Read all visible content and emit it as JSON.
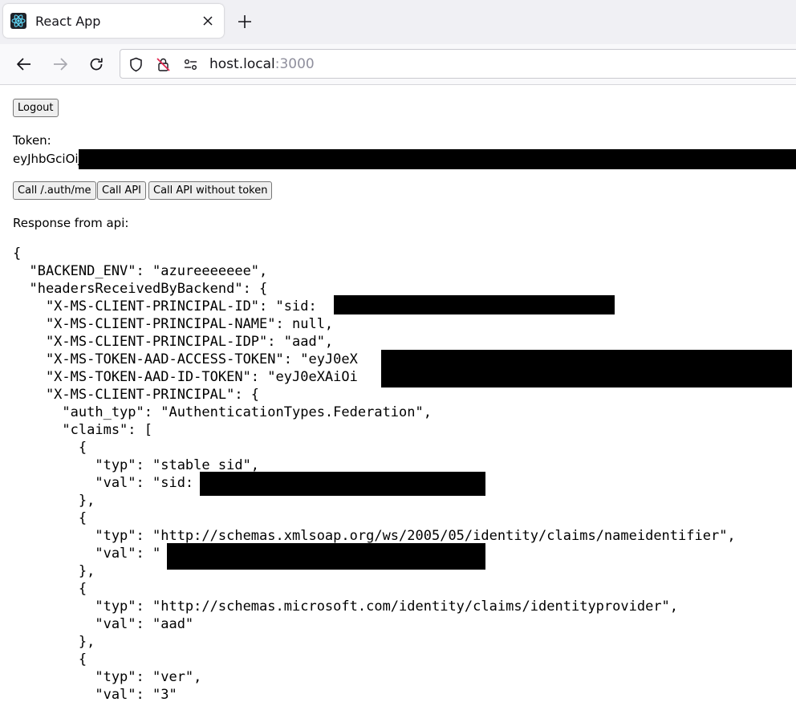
{
  "browser": {
    "tab": {
      "title": "React App",
      "favicon": "react-logo-icon"
    },
    "url": {
      "host": "host.local",
      "port": ":3000"
    }
  },
  "page": {
    "logout_label": "Logout",
    "token_label": "Token:",
    "token_value": "eyJhbGciOiJ",
    "buttons": {
      "call_auth_me": "Call /.auth/me",
      "call_api": "Call API",
      "call_api_no_token": "Call API without token"
    },
    "response_label": "Response from api:",
    "json_lines": [
      "{",
      "  \"BACKEND_ENV\": \"azureeeeeee\",",
      "  \"headersReceivedByBackend\": {",
      "    \"X-MS-CLIENT-PRINCIPAL-ID\": \"sid:                                \",",
      "    \"X-MS-CLIENT-PRINCIPAL-NAME\": null,",
      "    \"X-MS-CLIENT-PRINCIPAL-IDP\": \"aad\",",
      "    \"X-MS-TOKEN-AAD-ACCESS-TOKEN\": \"eyJ0eX",
      "    \"X-MS-TOKEN-AAD-ID-TOKEN\": \"eyJ0eXAiOi",
      "    \"X-MS-CLIENT-PRINCIPAL\": {",
      "      \"auth_typ\": \"AuthenticationTypes.Federation\",",
      "      \"claims\": [",
      "        {",
      "          \"typ\": \"stable_sid\",",
      "          \"val\": \"sid:                                \"",
      "        },",
      "        {",
      "          \"typ\": \"http://schemas.xmlsoap.org/ws/2005/05/identity/claims/nameidentifier\",",
      "          \"val\": \"                                     \"",
      "        },",
      "        {",
      "          \"typ\": \"http://schemas.microsoft.com/identity/claims/identityprovider\",",
      "          \"val\": \"aad\"",
      "        },",
      "        {",
      "          \"typ\": \"ver\",",
      "          \"val\": \"3\""
    ]
  }
}
